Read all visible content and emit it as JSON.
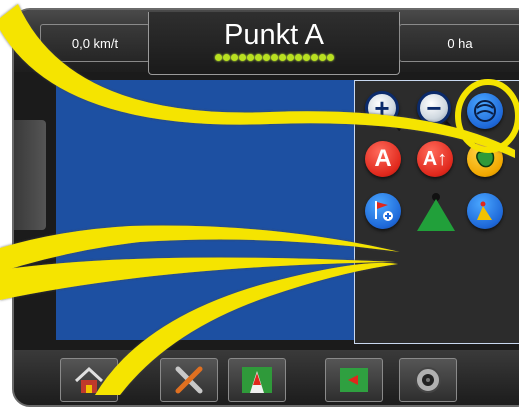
{
  "topbar": {
    "speed": "0,0 km/t",
    "title": "Punkt A",
    "area": "0 ha",
    "lightbar_leds": 15
  },
  "colors": {
    "map": "#1d50a2",
    "callout": "#f5e400",
    "led": "#b8e020"
  },
  "tools": [
    {
      "name": "zoom-in-icon"
    },
    {
      "name": "zoom-out-icon"
    },
    {
      "name": "guideline-mode-icon"
    },
    {
      "name": "mark-a-label",
      "label": "A"
    },
    {
      "name": "mark-a-plus-label",
      "label": "A↑"
    },
    {
      "name": "boundary-icon"
    },
    {
      "name": "add-poi-flag-icon"
    },
    {
      "name": "vehicle-view-icon"
    },
    {
      "name": "perspective-view-icon"
    }
  ],
  "bottom_nav": [
    {
      "name": "home-icon"
    },
    {
      "name": "tools-icon"
    },
    {
      "name": "guidance-icon"
    },
    {
      "name": "map-view-icon"
    },
    {
      "name": "camera-icon"
    }
  ]
}
